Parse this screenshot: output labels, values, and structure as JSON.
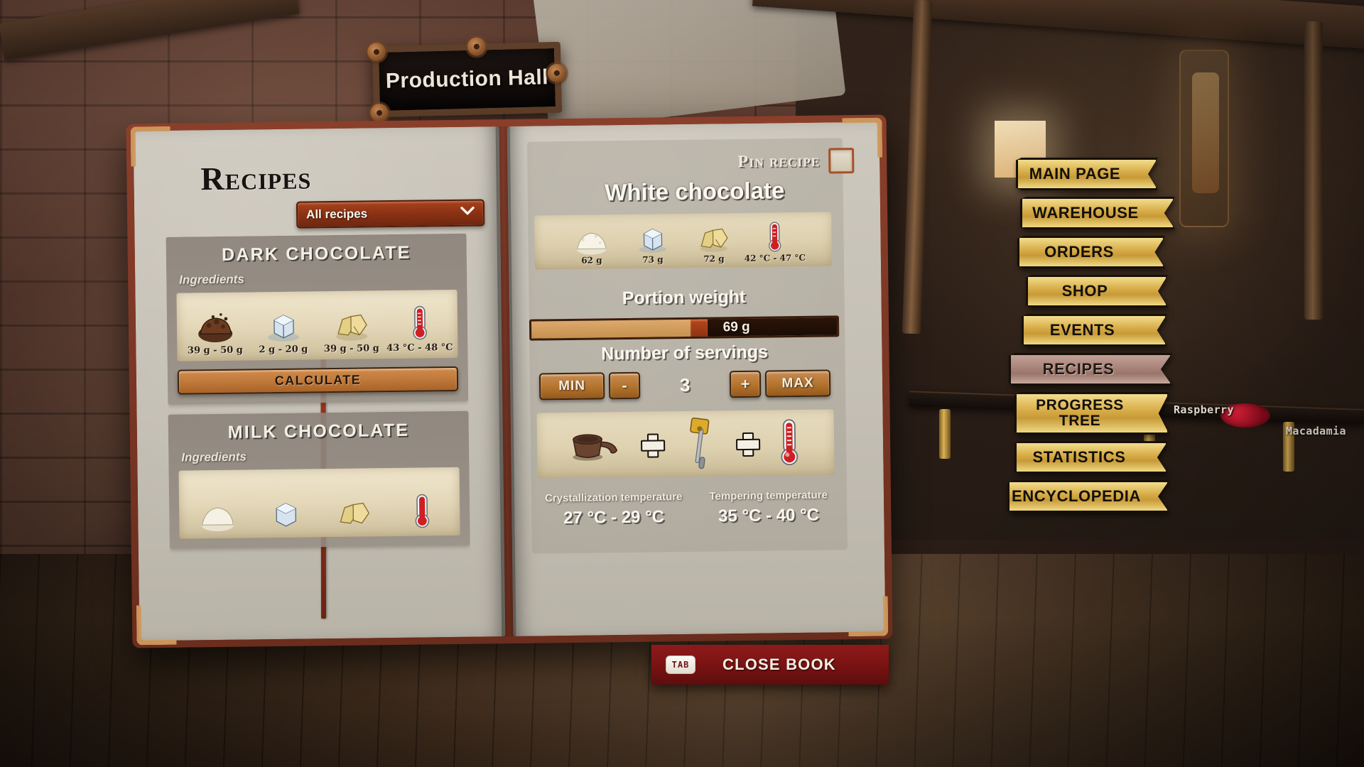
{
  "scene": {
    "hall_sign": "Production Hall",
    "shelf_labels": [
      "Raspberry",
      "Macadamia"
    ]
  },
  "book": {
    "left_page": {
      "title": "Recipes",
      "filter": {
        "value": "All recipes",
        "icon": "chevron-down-icon"
      },
      "ingredients_caption": "Ingredients",
      "calculate_label": "CALCULATE",
      "recipes": [
        {
          "name": "DARK CHOCOLATE",
          "ingredients": [
            {
              "icon": "cocoa-mass-icon",
              "amount": "39 g - 50 g"
            },
            {
              "icon": "sugar-cube-icon",
              "amount": "2 g - 20 g"
            },
            {
              "icon": "cocoa-butter-icon",
              "amount": "39 g - 50 g"
            },
            {
              "icon": "thermometer-icon",
              "amount": "43 °C - 48 °C"
            }
          ]
        },
        {
          "name": "MILK CHOCOLATE",
          "ingredients": [
            {
              "icon": "milk-powder-icon",
              "amount": ""
            },
            {
              "icon": "sugar-cube-icon",
              "amount": ""
            },
            {
              "icon": "cocoa-butter-icon",
              "amount": ""
            },
            {
              "icon": "thermometer-icon",
              "amount": ""
            }
          ]
        }
      ]
    },
    "right_page": {
      "pin_label": "Pin recipe",
      "pin_checked": false,
      "recipe_name": "White chocolate",
      "ingredients": [
        {
          "icon": "milk-powder-icon",
          "amount": "62 g"
        },
        {
          "icon": "sugar-cube-icon",
          "amount": "73 g"
        },
        {
          "icon": "cocoa-butter-icon",
          "amount": "72 g"
        },
        {
          "icon": "thermometer-icon",
          "amount": "42 °C - 47 °C"
        }
      ],
      "portion_weight": {
        "heading": "Portion weight",
        "value": "69 g",
        "fill_percent": 52
      },
      "servings": {
        "heading": "Number of servings",
        "min_label": "MIN",
        "minus_label": "-",
        "count": "3",
        "plus_label": "+",
        "max_label": "MAX"
      },
      "tools": [
        {
          "icon": "melting-pot-icon"
        },
        {
          "icon": "plus-icon"
        },
        {
          "icon": "spatula-icon"
        },
        {
          "icon": "plus-icon"
        },
        {
          "icon": "thermometer-icon"
        }
      ],
      "temperatures": [
        {
          "caption": "Crystallization temperature",
          "value": "27 °C - 29 °C"
        },
        {
          "caption": "Tempering temperature",
          "value": "35 °C - 40 °C"
        }
      ]
    }
  },
  "nav": {
    "items": [
      {
        "label": "MAIN PAGE",
        "active": false
      },
      {
        "label": "WAREHOUSE",
        "active": false
      },
      {
        "label": "ORDERS",
        "active": false
      },
      {
        "label": "SHOP",
        "active": false
      },
      {
        "label": "EVENTS",
        "active": false
      },
      {
        "label": "RECIPES",
        "active": true
      },
      {
        "label": "PROGRESS TREE",
        "active": false
      },
      {
        "label": "STATISTICS",
        "active": false
      },
      {
        "label": "ENCYCLOPEDIA",
        "active": false
      }
    ]
  },
  "footer": {
    "key": "TAB",
    "label": "CLOSE BOOK"
  },
  "colors": {
    "banner_gold": "#d8ad49",
    "banner_active": "#a78378",
    "page_paper": "#c4bfb4",
    "accent_orange": "#c17b3c",
    "dropdown_red": "#8d3314",
    "close_bar_red": "#7d1414"
  }
}
